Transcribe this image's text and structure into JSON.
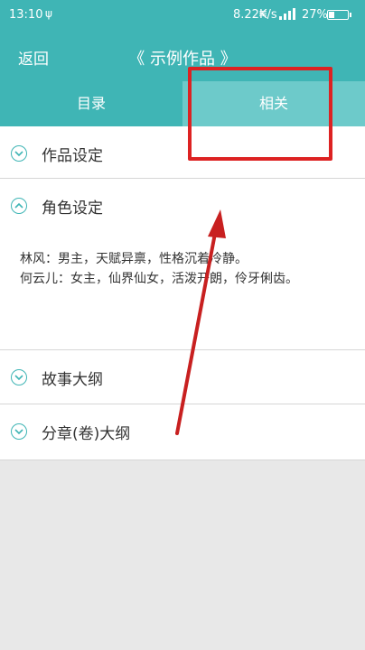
{
  "status_bar": {
    "time": "13:10",
    "usb_glyph": "ψ",
    "speed": "8.22K/s",
    "wifi_glyph": "≋",
    "battery_pct": "27%",
    "battery_level": 0.27
  },
  "header": {
    "back_label": "返回",
    "title": "《 示例作品 》"
  },
  "tabs": [
    {
      "label": "目录",
      "selected": false
    },
    {
      "label": "相关",
      "selected": true
    }
  ],
  "sections": [
    {
      "label": "作品设定",
      "expanded": false
    },
    {
      "label": "角色设定",
      "expanded": true,
      "lines": [
        "林风：男主，天赋异禀，性格沉着冷静。",
        "何云儿：女主，仙界仙女，活泼开朗，伶牙俐齿。"
      ]
    },
    {
      "label": "故事大纲",
      "expanded": false
    },
    {
      "label": "分章(卷)大纲",
      "expanded": false
    }
  ],
  "colors": {
    "accent": "#3fb5b5",
    "tab_selected": "#6dcaca",
    "annotation": "#d22222"
  },
  "icons": [
    "usb-icon",
    "wifi-icon",
    "signal-icon",
    "battery-icon",
    "chevron-down-icon",
    "chevron-up-icon"
  ]
}
